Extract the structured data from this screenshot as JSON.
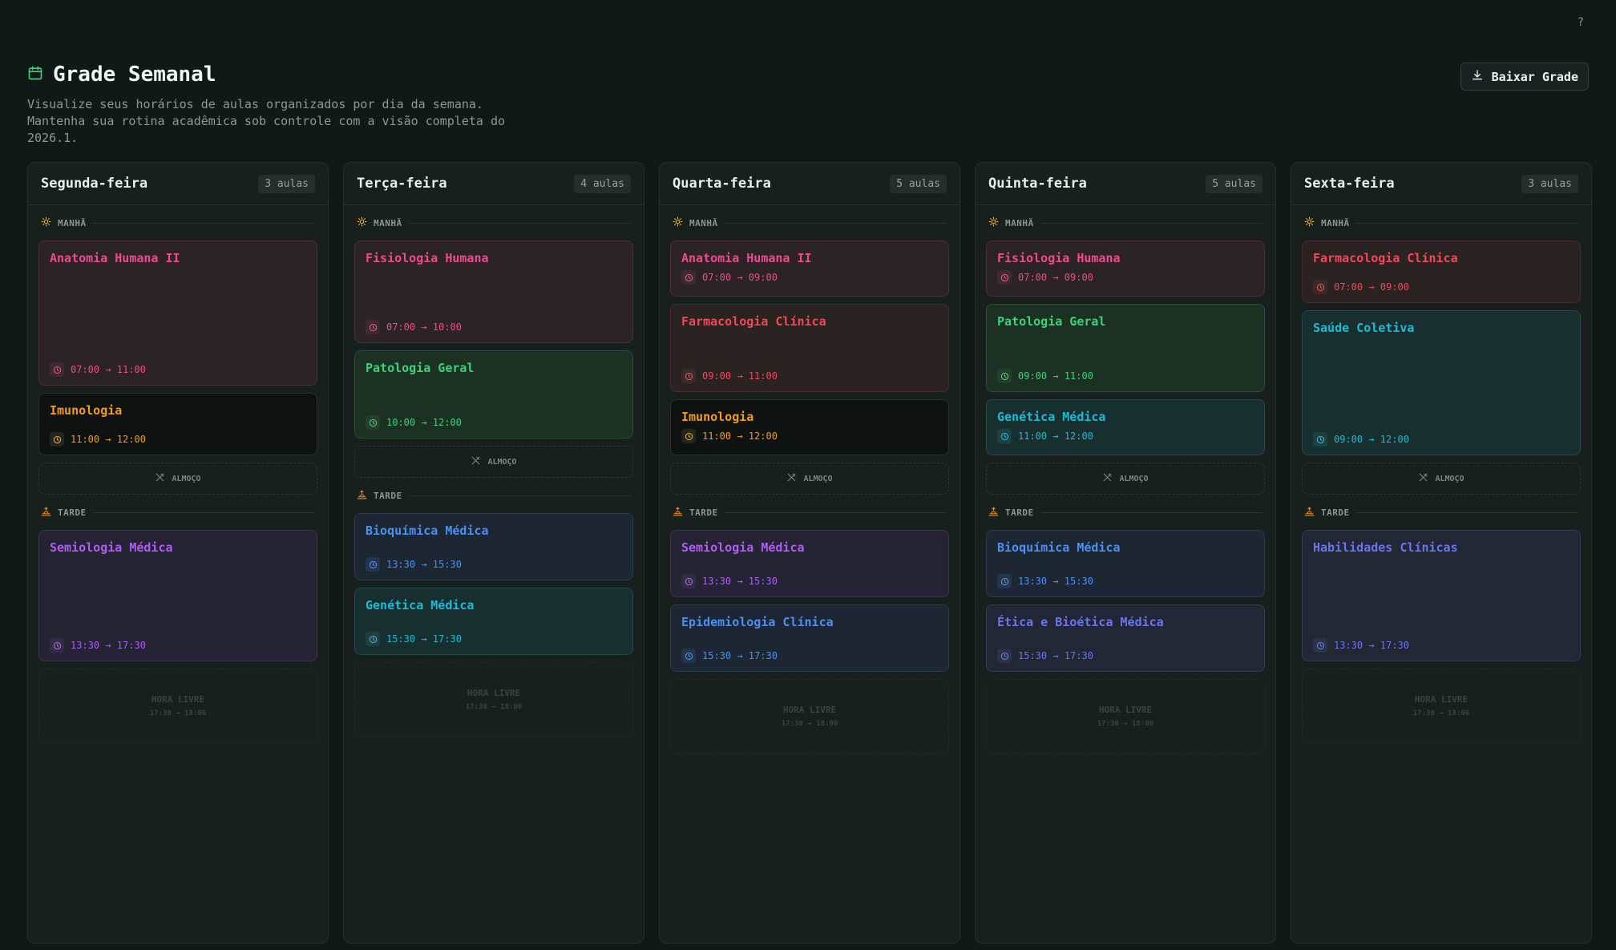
{
  "help_label": "?",
  "page": {
    "title": "Grade Semanal",
    "subtitle": "Visualize seus horários de aulas organizados por dia da semana. Mantenha sua rotina acadêmica sob controle com a visão completa do 2026.1.",
    "download_label": "Baixar Grade"
  },
  "labels": {
    "morning": "MANHÃ",
    "afternoon": "TARDE",
    "lunch": "ALMOÇO",
    "free": "HORA LIVRE",
    "free_time": "17:30 → 18:00"
  },
  "colors": {
    "pink": "#ef4b8c",
    "red": "#f1485a",
    "orange": "#f59a23",
    "green": "#3fd17a",
    "purple": "#b25cf4",
    "blue": "#4d8ff2",
    "teal": "#1fbad6",
    "indigo": "#6c74f0"
  },
  "days": [
    {
      "name": "Segunda-feira",
      "count": "3 aulas",
      "morning": [
        {
          "name": "Anatomia Humana II",
          "time": "07:00 → 11:00",
          "color": "pink",
          "hours": 4
        },
        {
          "name": "Imunologia",
          "time": "11:00 → 12:00",
          "color": "orange",
          "hours": 1
        }
      ],
      "afternoon": [
        {
          "name": "Semiologia Médica",
          "time": "13:30 → 17:30",
          "color": "purple",
          "hours": 4
        }
      ]
    },
    {
      "name": "Terça-feira",
      "count": "4 aulas",
      "morning": [
        {
          "name": "Fisiologia Humana",
          "time": "07:00 → 10:00",
          "color": "pink",
          "hours": 3
        },
        {
          "name": "Patologia Geral",
          "time": "10:00 → 12:00",
          "color": "green",
          "hours": 2
        }
      ],
      "afternoon": [
        {
          "name": "Bioquímica Médica",
          "time": "13:30 → 15:30",
          "color": "blue",
          "hours": 2
        },
        {
          "name": "Genética Médica",
          "time": "15:30 → 17:30",
          "color": "teal",
          "hours": 2
        }
      ]
    },
    {
      "name": "Quarta-feira",
      "count": "5 aulas",
      "morning": [
        {
          "name": "Anatomia Humana II",
          "time": "07:00 → 09:00",
          "color": "pink",
          "hours": 2
        },
        {
          "name": "Farmacologia Clínica",
          "time": "09:00 → 11:00",
          "color": "red",
          "hours": 2
        },
        {
          "name": "Imunologia",
          "time": "11:00 → 12:00",
          "color": "orange",
          "hours": 1
        }
      ],
      "afternoon": [
        {
          "name": "Semiologia Médica",
          "time": "13:30 → 15:30",
          "color": "purple",
          "hours": 2
        },
        {
          "name": "Epidemiologia Clínica",
          "time": "15:30 → 17:30",
          "color": "blue",
          "hours": 2
        }
      ]
    },
    {
      "name": "Quinta-feira",
      "count": "5 aulas",
      "morning": [
        {
          "name": "Fisiologia Humana",
          "time": "07:00 → 09:00",
          "color": "pink",
          "hours": 2
        },
        {
          "name": "Patologia Geral",
          "time": "09:00 → 11:00",
          "color": "green",
          "hours": 2
        },
        {
          "name": "Genética Médica",
          "time": "11:00 → 12:00",
          "color": "teal",
          "hours": 1
        }
      ],
      "afternoon": [
        {
          "name": "Bioquímica Médica",
          "time": "13:30 → 15:30",
          "color": "blue",
          "hours": 2
        },
        {
          "name": "Ética e Bioética Médica",
          "time": "15:30 → 17:30",
          "color": "indigo",
          "hours": 2
        }
      ]
    },
    {
      "name": "Sexta-feira",
      "count": "3 aulas",
      "morning": [
        {
          "name": "Farmacologia Clínica",
          "time": "07:00 → 09:00",
          "color": "red",
          "hours": 2
        },
        {
          "name": "Saúde Coletiva",
          "time": "09:00 → 12:00",
          "color": "teal",
          "hours": 3
        }
      ],
      "afternoon": [
        {
          "name": "Habilidades Clínicas",
          "time": "13:30 → 17:30",
          "color": "indigo",
          "hours": 4
        }
      ]
    }
  ]
}
